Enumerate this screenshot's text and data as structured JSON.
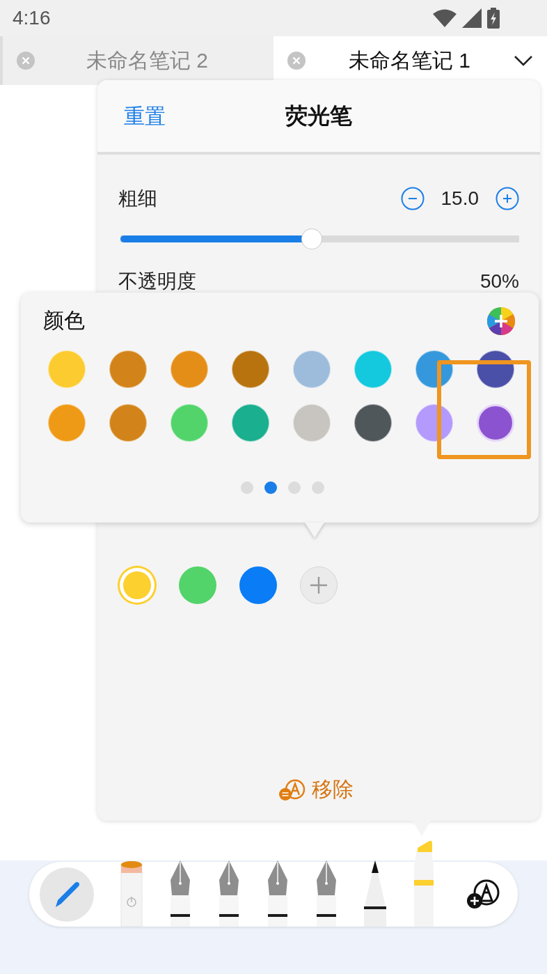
{
  "status_bar": {
    "time": "4:16"
  },
  "tabs": [
    {
      "title": "未命名笔记 2",
      "selected": false
    },
    {
      "title": "未命名笔记 1",
      "selected": true
    }
  ],
  "pen_panel": {
    "reset": "重置",
    "title": "荧光笔",
    "thickness": {
      "label": "粗细",
      "value": "15.0",
      "level": 0.48
    },
    "opacity": {
      "label": "不透明度",
      "value": "50%"
    },
    "recent_colors": [
      {
        "color": "#fcd02f",
        "selected": true
      },
      {
        "color": "#52d46a",
        "selected": false
      },
      {
        "color": "#0a7cf5",
        "selected": false
      }
    ],
    "remove": "移除"
  },
  "color_popup": {
    "title": "颜色",
    "swatches": [
      {
        "color": "#fccb2f",
        "highlighted": false
      },
      {
        "color": "#d2841a",
        "highlighted": false
      },
      {
        "color": "#e48e18",
        "highlighted": false
      },
      {
        "color": "#b8730f",
        "highlighted": false
      },
      {
        "color": "#9dbcdc",
        "highlighted": false
      },
      {
        "color": "#14c8de",
        "highlighted": false
      },
      {
        "color": "#3598dc",
        "highlighted": false
      },
      {
        "color": "#4a4fa8",
        "highlighted": false
      },
      {
        "color": "#ef9a16",
        "highlighted": false
      },
      {
        "color": "#d2841a",
        "highlighted": false
      },
      {
        "color": "#52d46a",
        "highlighted": false
      },
      {
        "color": "#1aaf8e",
        "highlighted": false
      },
      {
        "color": "#c8c4bf",
        "highlighted": false
      },
      {
        "color": "#50575b",
        "highlighted": false
      },
      {
        "color": "#b39afc",
        "highlighted": false
      },
      {
        "color": "#8c53d0",
        "highlighted": true
      }
    ],
    "pages": [
      {
        "selected": false
      },
      {
        "selected": true
      },
      {
        "selected": false
      },
      {
        "selected": false
      }
    ]
  },
  "toolbar": {
    "tools": [
      {
        "kind": "eraser",
        "selected": false
      },
      {
        "kind": "fountain-pen",
        "selected": false
      },
      {
        "kind": "fountain-pen",
        "selected": false
      },
      {
        "kind": "fountain-pen",
        "selected": false
      },
      {
        "kind": "fountain-pen",
        "selected": false
      },
      {
        "kind": "pencil",
        "selected": false
      },
      {
        "kind": "highlighter",
        "selected": true
      }
    ]
  }
}
